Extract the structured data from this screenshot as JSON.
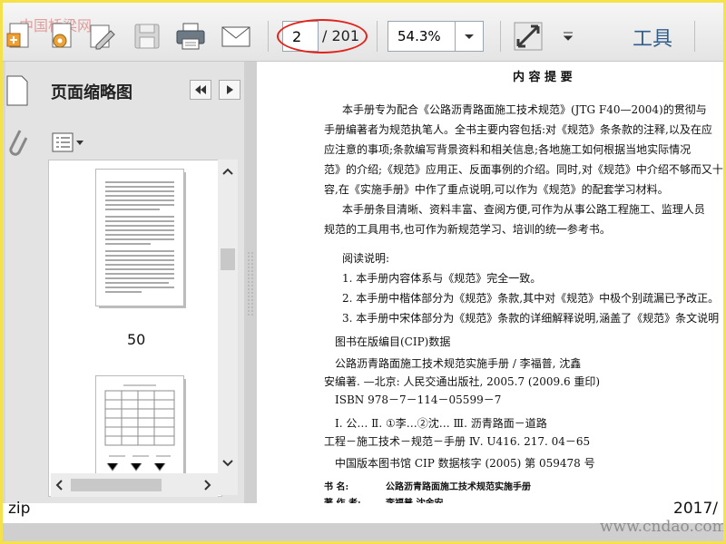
{
  "watermark_top": "中国桥梁网",
  "toolbar": {
    "current_page": "2",
    "total_pages": "/ 201",
    "zoom": "54.3%",
    "tools_label": "工具",
    "icons": [
      "create-pdf-icon",
      "settings-icon",
      "edit-icon",
      "save-icon",
      "print-icon",
      "email-icon",
      "fullscreen-icon",
      "menu-down-icon"
    ]
  },
  "sidebar": {
    "title": "页面缩略图",
    "thumbnails": [
      {
        "page_label": "50"
      },
      {
        "page_label": ""
      }
    ]
  },
  "document": {
    "heading": "内 容 提 要",
    "lines": [
      "本手册专为配合《公路沥青路面施工技术规范》(JTG F40—2004)的贯彻与",
      "手册编著者为规范执笔人。全书主要内容包括:对《规范》条条款的注释,以及在应",
      "应注意的事项;条款编写背景资料和相关信息;各地施工如何根据当地实际情况",
      "范》的介绍;《规范》应用正、反面事例的介绍。同时,对《规范》中介绍不够而又十",
      "容,在《实施手册》中作了重点说明,可以作为《规范》的配套学习材料。",
      "本手册条目清晰、资料丰富、查阅方便,可作为从事公路工程施工、监理人员",
      "规范的工具用书,也可作为新规范学习、培训的统一参考书。"
    ],
    "reading_title": "阅读说明:",
    "reading_items": [
      "1. 本手册内容体系与《规范》完全一致。",
      "2. 本手册中楷体部分为《规范》条款,其中对《规范》中极个别疏漏已予改正。",
      "3. 本手册中宋体部分为《规范》条款的详细解释说明,涵盖了《规范》条文说明"
    ],
    "cip_title": "图书在版编目(CIP)数据",
    "cip_lines": [
      "公路沥青路面施工技术规范实施手册 / 李福普, 沈鑫",
      "安编著. —北京: 人民交通出版社, 2005.7 (2009.6 重印)",
      "ISBN 978－7－114－05599－7",
      "Ⅰ. 公… Ⅱ. ①李…②沈… Ⅲ. 沥青路面－道路",
      "工程－施工技术－规范－手册 Ⅳ. U416. 217. 04－65"
    ],
    "cip_number": "中国版本图书馆 CIP 数据核字 (2005) 第 059478 号",
    "book_label": "书    名:",
    "book_name": "公路沥青路面施工技术规范实施手册",
    "author_label": "著 作 者:",
    "authors": "李福普   沈金安"
  },
  "footer": {
    "left_text": "zip",
    "right_text": "2017/",
    "watermark": "www.cndao.com"
  },
  "colors": {
    "border": "#f5e14a",
    "highlight": "#e0241c",
    "tools": "#2f5d8c"
  }
}
